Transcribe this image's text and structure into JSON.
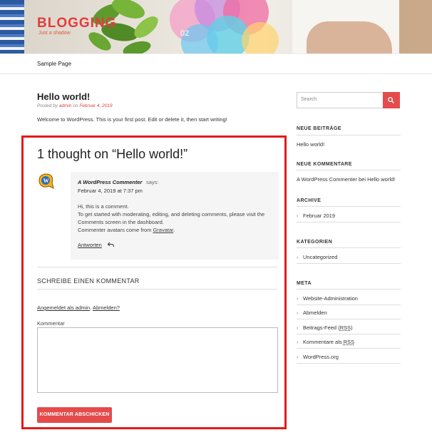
{
  "header": {
    "site_title": "BLOGGING",
    "site_description": "Just a shadow"
  },
  "nav": {
    "items": [
      "Sample Page"
    ]
  },
  "post": {
    "title": "Hello world!",
    "meta_prefix": "Posted by",
    "meta_author": "admin",
    "meta_on": "on",
    "meta_date": "Februar 4, 2019",
    "content": "Welcome to WordPress. This is your first post. Edit or delete it, then start writing!"
  },
  "comments": {
    "heading": "1 thought on “Hello world!”",
    "items": [
      {
        "author": "A WordPress Commenter",
        "says": "says:",
        "date": "Februar 4, 2019 at 7:37 pm",
        "line1": "Hi, this is a comment.",
        "line2": "To get started with moderating, editing, and deleting comments, please visit the Comments screen in the dashboard.",
        "line3_prefix": "Commenter avatars come from",
        "line3_link": "Gravatar",
        "line3_suffix": ".",
        "reply": "Antworten"
      }
    ]
  },
  "comment_form": {
    "heading": "SCHREIBE EINEN KOMMENTAR",
    "logged_in_link": "Angemeldet als admin",
    "logged_in_sep": ".",
    "logout_link": "Abmelden?",
    "field_label": "Kommentar",
    "textarea_value": "",
    "submit_label": "KOMMENTAR ABSCHICKEN"
  },
  "sidebar": {
    "search_placeholder": "Search",
    "recent_posts": {
      "title": "NEUE BEITRÄGE",
      "items": [
        "Hello world!"
      ]
    },
    "recent_comments": {
      "title": "NEUE KOMMENTARE",
      "text": "A WordPress Commenter bei Hello world!"
    },
    "archives": {
      "title": "ARCHIVE",
      "items": [
        "Februar 2019"
      ]
    },
    "categories": {
      "title": "KATEGORIEN",
      "items": [
        "Uncategorized"
      ]
    },
    "meta": {
      "title": "META",
      "items": [
        "Website-Administration",
        "Abmelden",
        "Beitrags-Feed",
        "Kommentare als",
        "WordPress.org"
      ],
      "rss": "RSS"
    }
  },
  "colors": {
    "accent": "#e54b4b",
    "highlight_border": "#e21b1b",
    "title_red": "#e53b3b"
  },
  "icons": {
    "search": "search-icon",
    "reply": "reply-arrow-icon",
    "avatar": "wordpress-avatar-icon"
  }
}
